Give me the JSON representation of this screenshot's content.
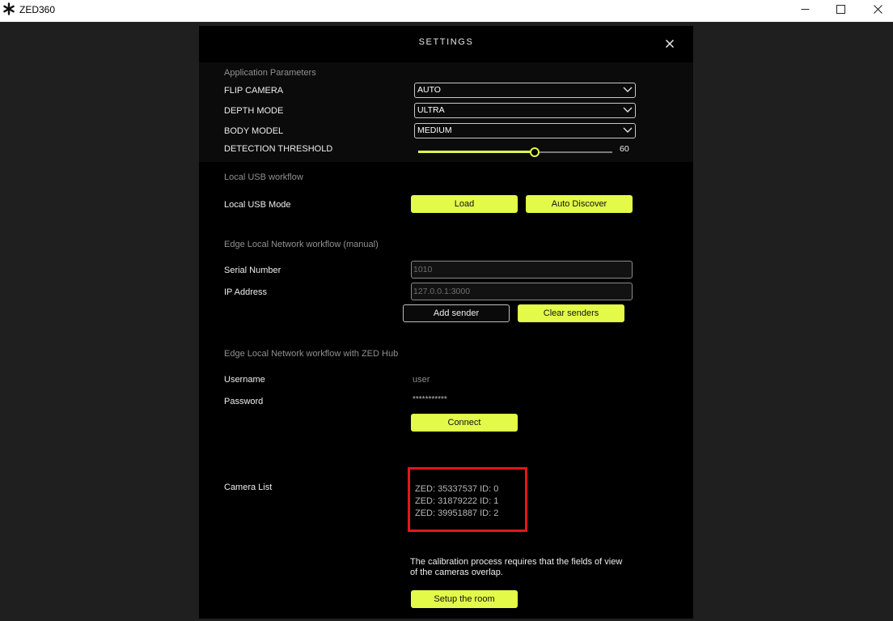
{
  "window": {
    "title": "ZED360",
    "logo_icon": "asterisk-logo",
    "controls": [
      "minimize",
      "maximize",
      "close"
    ]
  },
  "settings": {
    "title": "SETTINGS",
    "close_icon": "close-icon",
    "app_params": {
      "heading": "Application Parameters",
      "flip_camera": {
        "label": "FLIP CAMERA",
        "value": "AUTO"
      },
      "depth_mode": {
        "label": "DEPTH MODE",
        "value": "ULTRA"
      },
      "body_model": {
        "label": "BODY MODEL",
        "value": "MEDIUM"
      },
      "detection_threshold": {
        "label": "DETECTION THRESHOLD",
        "value": "60",
        "min": 0,
        "max": 100
      }
    },
    "usb": {
      "heading": "Local USB workflow",
      "label": "Local USB Mode",
      "load_label": "Load",
      "auto_discover_label": "Auto Discover"
    },
    "edge_manual": {
      "heading": "Edge Local Network workflow (manual)",
      "serial_label": "Serial Number",
      "serial_placeholder": "1010",
      "ip_label": "IP Address",
      "ip_placeholder": "127.0.0.1:3000",
      "add_sender_label": "Add sender",
      "clear_senders_label": "Clear senders"
    },
    "edge_hub": {
      "heading": "Edge Local Network workflow with ZED Hub",
      "username_label": "Username",
      "username_value": "user",
      "password_label": "Password",
      "password_value": "***********",
      "connect_label": "Connect"
    },
    "camera_list": {
      "label": "Camera List",
      "items": [
        "ZED: 35337537 ID: 0",
        "ZED: 31879222 ID: 1",
        "ZED: 39951887 ID: 2"
      ]
    },
    "calibration": {
      "line1": "The calibration process requires that the fields  of view",
      "line2": "of the cameras overlap.",
      "setup_label": "Setup the room"
    }
  },
  "colors": {
    "accent": "#e3fb48",
    "highlight": "#e01919",
    "panel": "#000000",
    "backdrop": "#1f1f1f"
  }
}
